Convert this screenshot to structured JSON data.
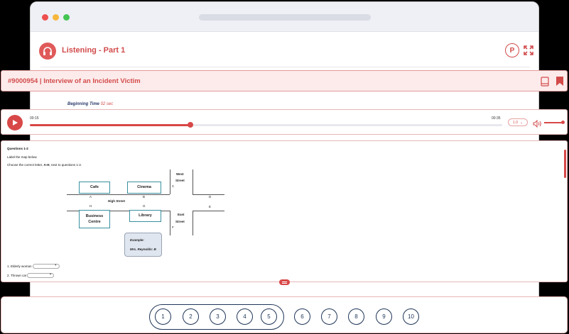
{
  "header": {
    "title": "Listening - Part 1",
    "p_label": "P"
  },
  "test": {
    "title": "#9000954 | Interview of an Incident Victim"
  },
  "beginning": {
    "label": "Beginning Time",
    "value": "02 sec"
  },
  "player": {
    "current": "00:15",
    "total": "00:35",
    "speed": "1.0",
    "progress": 0.34,
    "volume": 1.0
  },
  "question": {
    "heading": "Questions 1-2",
    "instruction1": "Label the map below.",
    "instruction2_pre": "Choose the correct letter,",
    "instruction2_letters": "A-H",
    "instruction2_post": ", next to questions 1-2."
  },
  "map": {
    "west_street_1": "West",
    "west_street_2": "Street",
    "east_street_1": "East",
    "east_street_2": "Street",
    "high_street": "High Street",
    "cafe": "Cafe",
    "cinema": "Cinema",
    "business_1": "Business",
    "business_2": "Centre",
    "library": "Library",
    "letters": {
      "A": "A",
      "B": "B",
      "C": "C",
      "D": "D",
      "E": "E",
      "F": "F",
      "G": "G",
      "H": "H"
    },
    "example_label": "Example:",
    "example_text": "Mrs. Reynolds: B"
  },
  "answers": [
    {
      "label": "1. Elderly woman"
    },
    {
      "label": "2. Thrown car"
    }
  ],
  "nav": {
    "numbers": [
      "1",
      "2",
      "3",
      "4",
      "5",
      "6",
      "7",
      "8",
      "9",
      "10"
    ]
  },
  "colors": {
    "accent": "#d84848",
    "navy": "#1f3558",
    "teal": "#3a8f9f"
  }
}
